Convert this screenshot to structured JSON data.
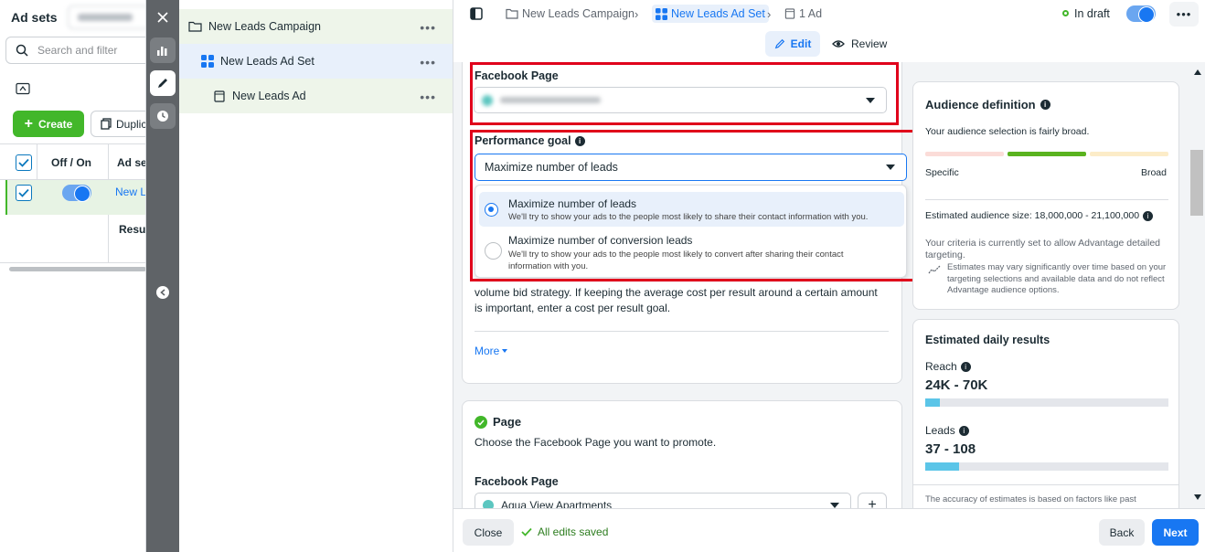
{
  "adsets": {
    "title": "Ad sets",
    "search_placeholder": "Search and filter",
    "create_label": "Create",
    "duplicate_label": "Duplic",
    "col_off_on": "Off / On",
    "col_adset": "Ad set",
    "row_name": "New L",
    "result_label": "Resul"
  },
  "tree": {
    "campaign": "New Leads Campaign",
    "adset": "New Leads Ad Set",
    "ad": "New Leads Ad"
  },
  "header": {
    "crumb_campaign": "New Leads Campaign",
    "crumb_adset": "New Leads Ad Set",
    "crumb_ad": "1 Ad",
    "status": "In draft",
    "edit_label": "Edit",
    "review_label": "Review"
  },
  "form": {
    "facebook_page_label": "Facebook Page",
    "performance_goal_label": "Performance goal",
    "performance_goal_value": "Maximize number of leads",
    "options": [
      {
        "title": "Maximize number of leads",
        "desc": "We'll try to show your ads to the people most likely to share their contact information with you.",
        "selected": true
      },
      {
        "title": "Maximize number of conversion leads",
        "desc": "We'll try to show your ads to the people most likely to convert after sharing their contact information with you.",
        "selected": false
      }
    ],
    "body_text": "volume bid strategy. If keeping the average cost per result around a certain amount is important, enter a cost per result goal.",
    "more_label": "More",
    "page_section_title": "Page",
    "page_section_desc": "Choose the Facebook Page you want to promote.",
    "page_section_label": "Facebook Page",
    "page_value": "Aqua View Apartments"
  },
  "audience": {
    "title": "Audience definition",
    "summary": "Your audience selection is fairly broad.",
    "specific": "Specific",
    "broad": "Broad",
    "size": "Estimated audience size: 18,000,000 - 21,100,000",
    "criteria": "Your criteria is currently set to allow Advantage detailed targeting.",
    "estimates_note": "Estimates may vary significantly over time based on your targeting selections and available data and do not reflect Advantage audience options."
  },
  "daily": {
    "title": "Estimated daily results",
    "reach_label": "Reach",
    "reach_value": "24K - 70K",
    "reach_fill": 0.06,
    "leads_label": "Leads",
    "leads_value": "37 - 108",
    "leads_fill": 0.14,
    "accuracy_note": "The accuracy of estimates is based on factors like past"
  },
  "footer": {
    "close_label": "Close",
    "saved_label": "All edits saved",
    "back_label": "Back",
    "next_label": "Next"
  },
  "colors": {
    "accent": "#1877f2",
    "highlight": "#e0001b",
    "success": "#42b72a",
    "create_green": "#42b72a"
  }
}
